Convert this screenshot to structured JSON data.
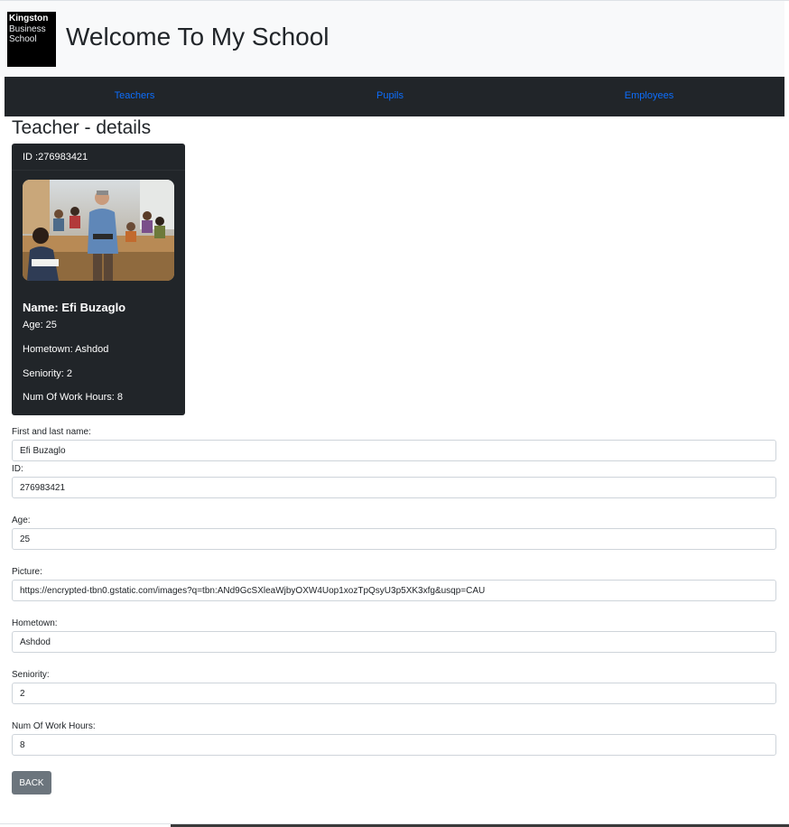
{
  "header": {
    "logo_line1": "Kingston",
    "logo_line2": "Business",
    "logo_line3": "School",
    "title": "Welcome To My School"
  },
  "nav": {
    "items": [
      {
        "label": "Teachers"
      },
      {
        "label": "Pupils"
      },
      {
        "label": "Employees"
      }
    ]
  },
  "page": {
    "heading": "Teacher - details"
  },
  "card": {
    "id_text": "ID :276983421",
    "name_text": "Name: Efi Buzaglo",
    "age_text": "Age: 25",
    "hometown_text": "Hometown: Ashdod",
    "seniority_text": "Seniority: 2",
    "hours_text": "Num Of Work Hours: 8"
  },
  "form": {
    "name_label": "First and last name:",
    "name_value": "Efi Buzaglo",
    "id_label": "ID:",
    "id_value": "276983421",
    "age_label": "Age:",
    "age_value": "25",
    "picture_label": "Picture:",
    "picture_value": "https://encrypted-tbn0.gstatic.com/images?q=tbn:ANd9GcSXleaWjbyOXW4Uop1xozTpQsyU3p5XK3xfg&usqp=CAU",
    "hometown_label": "Hometown:",
    "hometown_value": "Ashdod",
    "seniority_label": "Seniority:",
    "seniority_value": "2",
    "hours_label": "Num Of Work Hours:",
    "hours_value": "8",
    "back_label": "BACK"
  },
  "colors": {
    "navbar_bg": "#212529",
    "nav_link": "#0d6efd",
    "header_bg": "#f8f9fa",
    "card_bg": "#212529",
    "back_button": "#6c757d"
  }
}
